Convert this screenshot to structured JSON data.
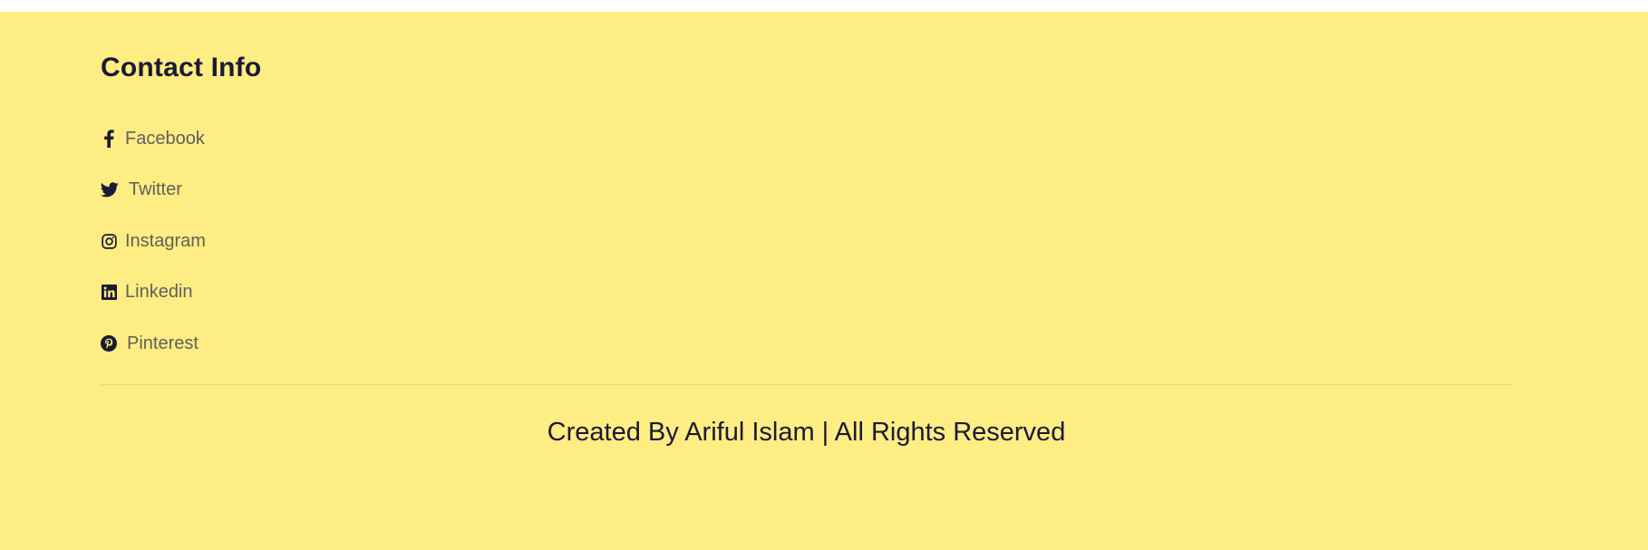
{
  "colors": {
    "footer_background": "#feed82",
    "heading": "#1b1a33",
    "link_text": "#5f5f63",
    "icon": "#1b1a33",
    "divider": "#e2d68a"
  },
  "contact": {
    "title": "Contact Info",
    "links": [
      {
        "label": "Facebook",
        "icon": "facebook-icon"
      },
      {
        "label": "Twitter",
        "icon": "twitter-icon"
      },
      {
        "label": "Instagram",
        "icon": "instagram-icon"
      },
      {
        "label": "Linkedin",
        "icon": "linkedin-icon"
      },
      {
        "label": "Pinterest",
        "icon": "pinterest-icon"
      }
    ]
  },
  "footer": {
    "copyright": "Created By Ariful Islam | All Rights Reserved"
  }
}
